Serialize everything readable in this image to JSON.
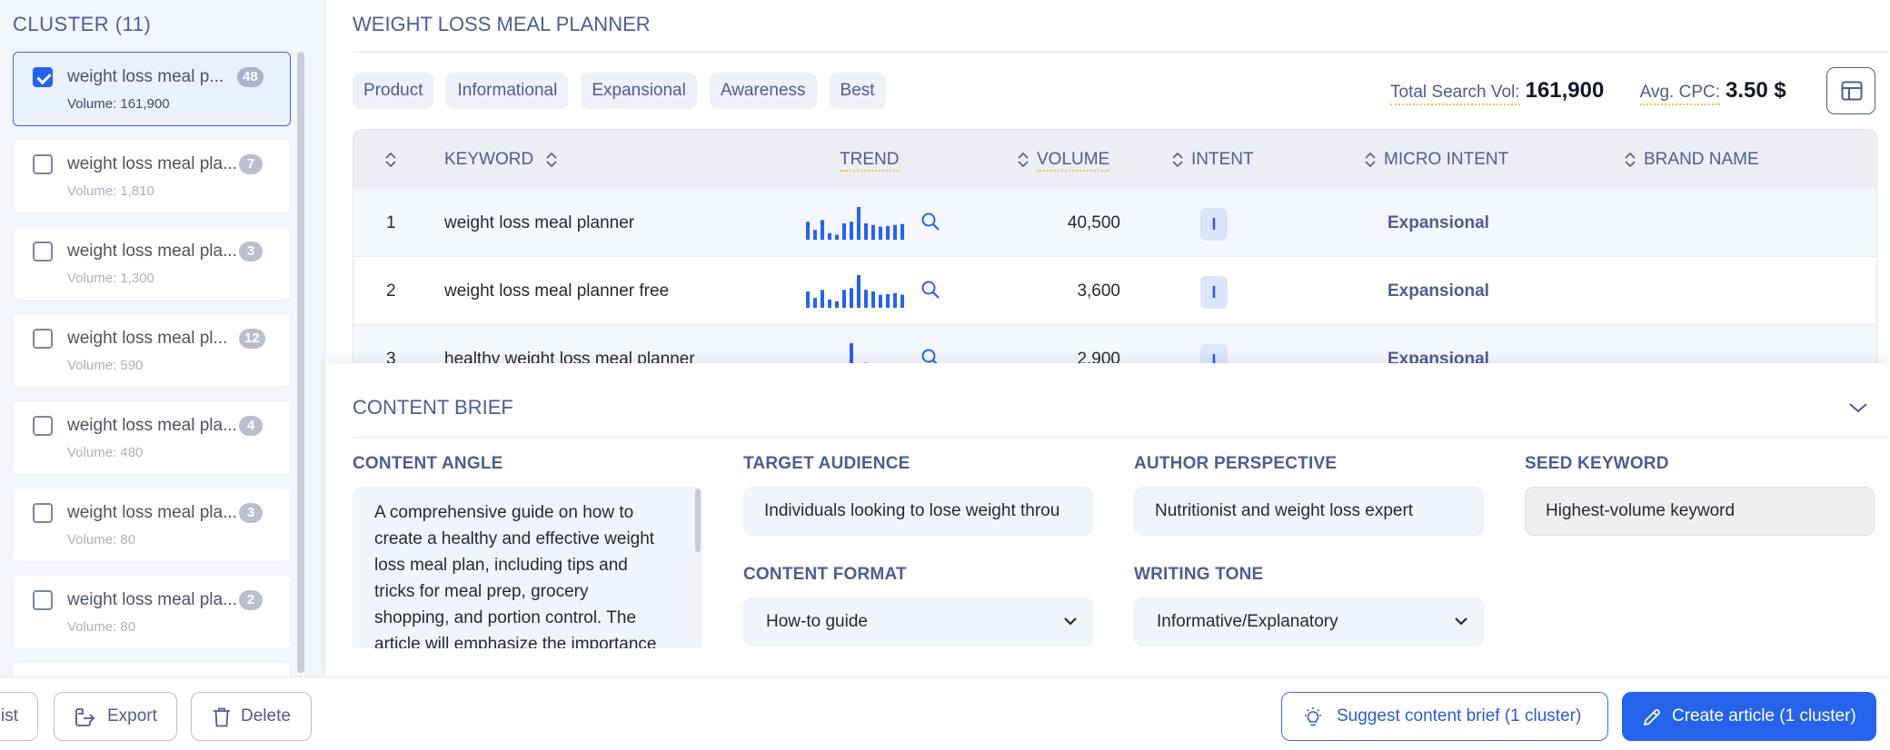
{
  "sidebar": {
    "title": "CLUSTER (11)",
    "items": [
      {
        "name": "weight loss meal p...",
        "count": "48",
        "volume": "Volume: 161,900",
        "checked": true
      },
      {
        "name": "weight loss meal pla...",
        "count": "7",
        "volume": "Volume: 1,810",
        "checked": false
      },
      {
        "name": "weight loss meal pla...",
        "count": "3",
        "volume": "Volume: 1,300",
        "checked": false
      },
      {
        "name": "weight loss meal pl...",
        "count": "12",
        "volume": "Volume: 590",
        "checked": false
      },
      {
        "name": "weight loss meal pla...",
        "count": "4",
        "volume": "Volume: 480",
        "checked": false
      },
      {
        "name": "weight loss meal pla...",
        "count": "3",
        "volume": "Volume: 80",
        "checked": false
      },
      {
        "name": "weight loss meal pla...",
        "count": "2",
        "volume": "Volume: 80",
        "checked": false
      }
    ]
  },
  "main": {
    "title": "WEIGHT LOSS MEAL PLANNER",
    "chips": [
      "Product",
      "Informational",
      "Expansional",
      "Awareness",
      "Best"
    ],
    "stats": {
      "total_label": "Total Search Vol:",
      "total_value": "161,900",
      "cpc_label": "Avg. CPC:",
      "cpc_value": "3.50 $"
    }
  },
  "table": {
    "headers": {
      "keyword": "KEYWORD",
      "trend": "TREND",
      "volume": "VOLUME",
      "intent": "INTENT",
      "micro_intent": "MICRO INTENT",
      "brand_name": "BRAND NAME"
    },
    "rows": [
      {
        "index": "1",
        "keyword": "weight loss meal planner",
        "volume": "40,500",
        "intent": "I",
        "micro_intent": "Expansional",
        "trend": [
          0.55,
          0.3,
          0.6,
          0.2,
          0.15,
          0.5,
          0.55,
          1.0,
          0.5,
          0.45,
          0.4,
          0.42,
          0.45,
          0.48
        ]
      },
      {
        "index": "2",
        "keyword": "weight loss meal planner free",
        "volume": "3,600",
        "intent": "I",
        "micro_intent": "Expansional",
        "trend": [
          0.5,
          0.3,
          0.55,
          0.25,
          0.2,
          0.55,
          0.6,
          1.0,
          0.55,
          0.5,
          0.4,
          0.42,
          0.45,
          0.4
        ]
      },
      {
        "index": "3",
        "keyword": "healthy weight loss meal planner",
        "volume": "2,900",
        "intent": "I",
        "micro_intent": "Expansional",
        "trend": [
          0,
          0,
          0,
          0,
          0,
          0,
          1.0,
          0,
          0.4,
          0,
          0,
          0,
          0,
          0
        ]
      }
    ]
  },
  "brief": {
    "title": "CONTENT BRIEF",
    "content_angle_label": "CONTENT ANGLE",
    "content_angle_text": "A comprehensive guide on how to create a healthy and effective weight loss meal plan, including tips and tricks for meal prep, grocery shopping, and portion control. The article will emphasize the importance",
    "target_audience_label": "TARGET AUDIENCE",
    "target_audience_value": "Individuals looking to lose weight throu",
    "author_perspective_label": "AUTHOR PERSPECTIVE",
    "author_perspective_value": "Nutritionist and weight loss expert",
    "seed_keyword_label": "SEED KEYWORD",
    "seed_keyword_value": "Highest-volume keyword",
    "content_format_label": "CONTENT FORMAT",
    "content_format_value": "How-to guide",
    "writing_tone_label": "WRITING TONE",
    "writing_tone_value": "Informative/Explanatory"
  },
  "bottombar": {
    "list_label": "ist",
    "export_label": "Export",
    "delete_label": "Delete",
    "suggest_label": "Suggest content brief (1 cluster)",
    "create_label": "Create article (1 cluster)"
  },
  "colors": {
    "accent": "#2563eb",
    "heading": "#4b5d95",
    "trend_bar": "#2563eb",
    "sort_icon": "#5b6680"
  },
  "icons": [
    "check-icon",
    "sort-icon",
    "layout-columns-icon",
    "search-icon",
    "chevron-down-icon",
    "export-icon",
    "trash-icon",
    "lightbulb-icon",
    "pencil-icon"
  ]
}
